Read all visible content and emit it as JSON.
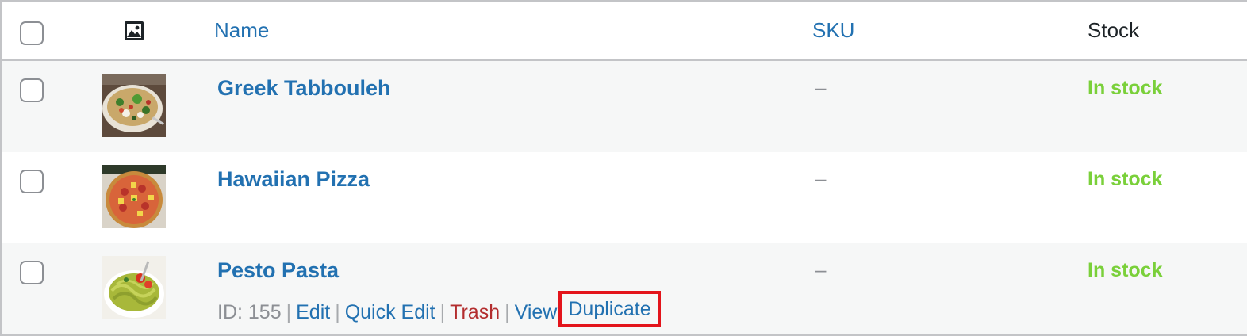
{
  "header": {
    "name_label": "Name",
    "sku_label": "SKU",
    "stock_label": "Stock",
    "image_icon": "image-icon"
  },
  "products": [
    {
      "name": "Greek Tabbouleh",
      "sku": "–",
      "stock": "In stock",
      "thumbnail": "salad-photo"
    },
    {
      "name": "Hawaiian Pizza",
      "sku": "–",
      "stock": "In stock",
      "thumbnail": "pizza-photo"
    },
    {
      "name": "Pesto Pasta",
      "sku": "–",
      "stock": "In stock",
      "thumbnail": "pasta-photo"
    }
  ],
  "row_actions": {
    "id_label": "ID: 155",
    "separator": "|",
    "edit": "Edit",
    "quick_edit": "Quick Edit",
    "trash": "Trash",
    "view": "View",
    "duplicate": "Duplicate"
  },
  "colors": {
    "link": "#2271b1",
    "in_stock": "#7ad03a",
    "trash": "#b32d2e",
    "highlight": "#e3141b",
    "alt_row": "#f6f7f7"
  }
}
